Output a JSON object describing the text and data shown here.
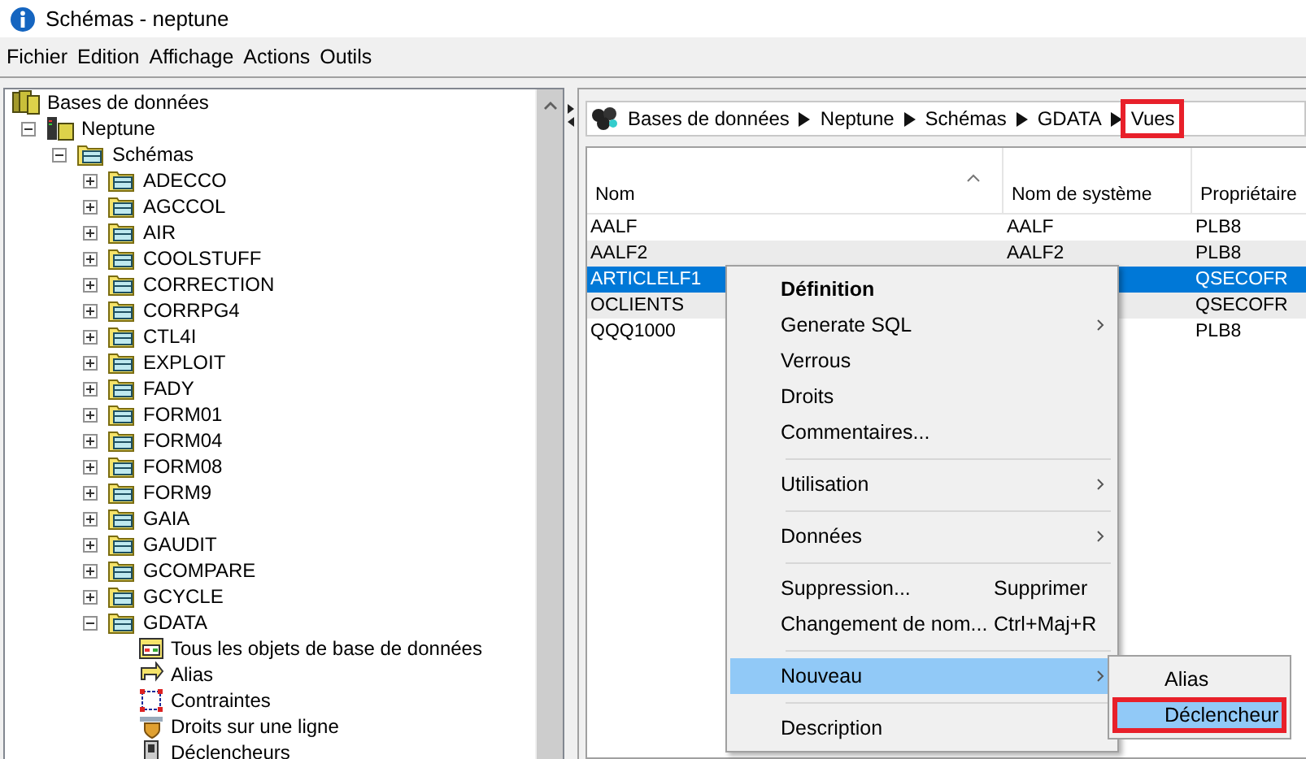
{
  "window": {
    "title": "Schémas - neptune"
  },
  "menu_bar": [
    "Fichier",
    "Edition",
    "Affichage",
    "Actions",
    "Outils"
  ],
  "tree": [
    {
      "label": "Bases de données",
      "kind": "databases",
      "children": [
        {
          "label": "Neptune",
          "kind": "server",
          "expanded": true,
          "children": [
            {
              "label": "Schémas",
              "kind": "schemas",
              "expanded": true,
              "children": [
                {
                  "label": "ADECCO",
                  "kind": "schema",
                  "expanded": false
                },
                {
                  "label": "AGCCOL",
                  "kind": "schema",
                  "expanded": false
                },
                {
                  "label": "AIR",
                  "kind": "schema",
                  "expanded": false
                },
                {
                  "label": "COOLSTUFF",
                  "kind": "schema",
                  "expanded": false
                },
                {
                  "label": "CORRECTION",
                  "kind": "schema",
                  "expanded": false
                },
                {
                  "label": "CORRPG4",
                  "kind": "schema",
                  "expanded": false
                },
                {
                  "label": "CTL4I",
                  "kind": "schema",
                  "expanded": false
                },
                {
                  "label": "EXPLOIT",
                  "kind": "schema",
                  "expanded": false
                },
                {
                  "label": "FADY",
                  "kind": "schema",
                  "expanded": false
                },
                {
                  "label": "FORM01",
                  "kind": "schema",
                  "expanded": false
                },
                {
                  "label": "FORM04",
                  "kind": "schema",
                  "expanded": false
                },
                {
                  "label": "FORM08",
                  "kind": "schema",
                  "expanded": false
                },
                {
                  "label": "FORM9",
                  "kind": "schema",
                  "expanded": false
                },
                {
                  "label": "GAIA",
                  "kind": "schema",
                  "expanded": false
                },
                {
                  "label": "GAUDIT",
                  "kind": "schema",
                  "expanded": false
                },
                {
                  "label": "GCOMPARE",
                  "kind": "schema",
                  "expanded": false
                },
                {
                  "label": "GCYCLE",
                  "kind": "schema",
                  "expanded": false
                },
                {
                  "label": "GDATA",
                  "kind": "schema",
                  "expanded": true,
                  "children": [
                    {
                      "label": "Tous les objets de base de données",
                      "kind": "objects"
                    },
                    {
                      "label": "Alias",
                      "kind": "alias"
                    },
                    {
                      "label": "Contraintes",
                      "kind": "constraints"
                    },
                    {
                      "label": "Droits sur une ligne",
                      "kind": "row-rights"
                    },
                    {
                      "label": "Déclencheurs",
                      "kind": "triggers"
                    }
                  ]
                }
              ]
            }
          ]
        }
      ]
    }
  ],
  "breadcrumb": [
    {
      "label": "Bases de données",
      "highlighted": false
    },
    {
      "label": "Neptune",
      "highlighted": false
    },
    {
      "label": "Schémas",
      "highlighted": false
    },
    {
      "label": "GDATA",
      "highlighted": false
    },
    {
      "label": "Vues",
      "highlighted": true
    }
  ],
  "table": {
    "columns": [
      "Nom",
      "Nom de système",
      "Propriétaire"
    ],
    "rows": [
      {
        "cells": [
          "AALF",
          "AALF",
          "PLB8"
        ],
        "selected": false
      },
      {
        "cells": [
          "AALF2",
          "AALF2",
          "PLB8"
        ],
        "selected": false
      },
      {
        "cells": [
          "ARTICLELF1",
          null,
          "QSECOFR"
        ],
        "selected": true
      },
      {
        "cells": [
          "OCLIENTS",
          null,
          "QSECOFR"
        ],
        "selected": false
      },
      {
        "cells": [
          "QQQ1000",
          null,
          "PLB8"
        ],
        "selected": false
      }
    ]
  },
  "context_menu": {
    "items": [
      {
        "kind": "item",
        "label": "Définition",
        "default": true,
        "has_submenu": false,
        "selected": false
      },
      {
        "kind": "item",
        "label": "Generate SQL",
        "default": false,
        "has_submenu": true,
        "selected": false
      },
      {
        "kind": "item",
        "label": "Verrous",
        "default": false,
        "has_submenu": false,
        "selected": false
      },
      {
        "kind": "item",
        "label": "Droits",
        "default": false,
        "has_submenu": false,
        "selected": false
      },
      {
        "kind": "item",
        "label": "Commentaires...",
        "default": false,
        "has_submenu": false,
        "selected": false
      },
      {
        "kind": "separator"
      },
      {
        "kind": "item",
        "label": "Utilisation",
        "default": false,
        "has_submenu": true,
        "selected": false
      },
      {
        "kind": "separator"
      },
      {
        "kind": "item",
        "label": "Données",
        "default": false,
        "has_submenu": true,
        "selected": false
      },
      {
        "kind": "separator"
      },
      {
        "kind": "item",
        "label": "Suppression...",
        "shortcut": "Supprimer",
        "default": false,
        "has_submenu": false,
        "selected": false
      },
      {
        "kind": "item",
        "label": "Changement de nom...",
        "shortcut": "Ctrl+Maj+R",
        "default": false,
        "has_submenu": false,
        "selected": false
      },
      {
        "kind": "separator"
      },
      {
        "kind": "item",
        "label": "Nouveau",
        "default": false,
        "has_submenu": true,
        "selected": true
      },
      {
        "kind": "separator"
      },
      {
        "kind": "item",
        "label": "Description",
        "default": false,
        "has_submenu": false,
        "selected": false
      }
    ],
    "submenu": [
      {
        "label": "Alias",
        "selected": false,
        "highlighted": false
      },
      {
        "label": "Déclencheur",
        "selected": true,
        "highlighted": true
      }
    ]
  }
}
